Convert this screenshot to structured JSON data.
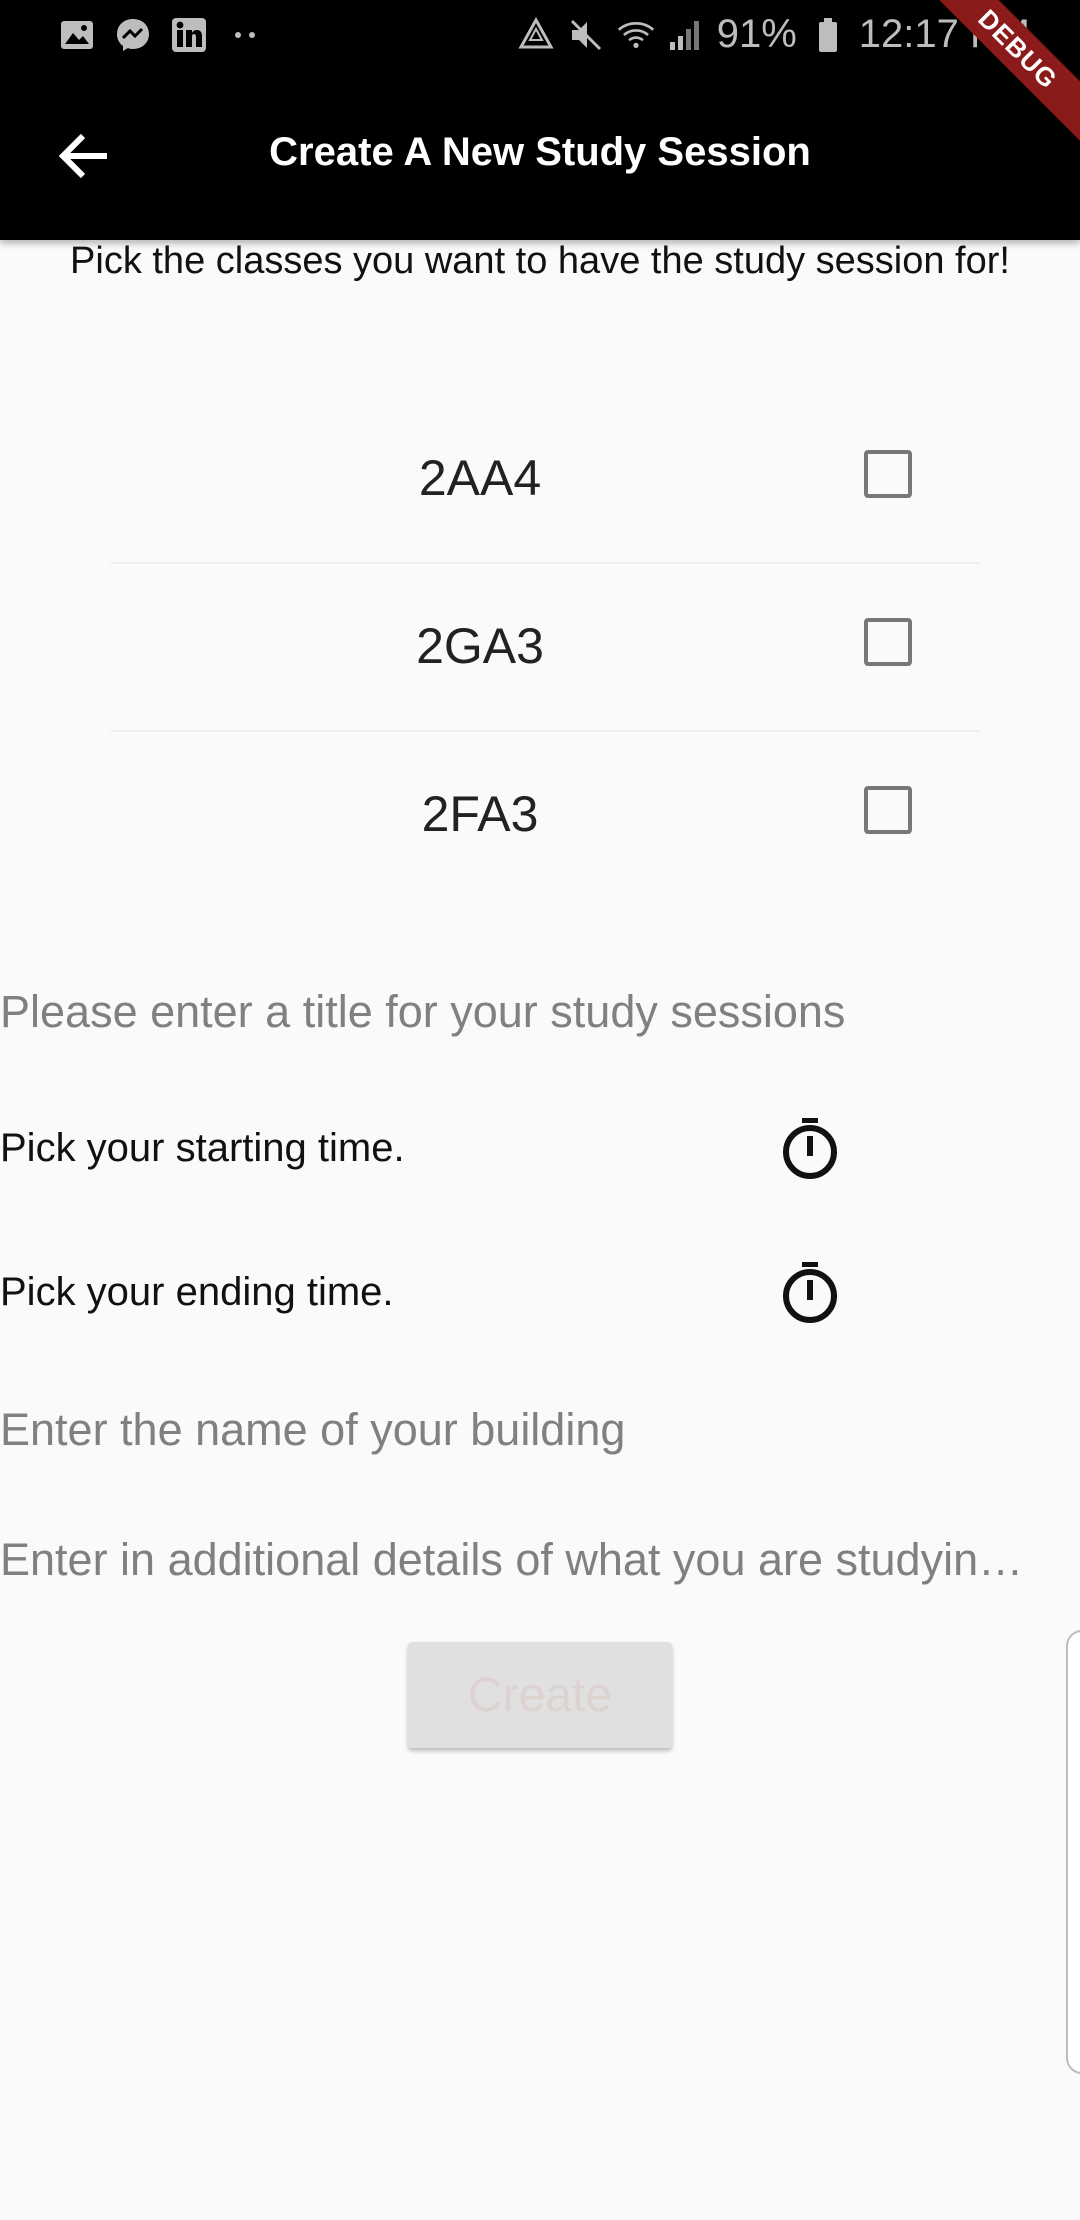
{
  "status_bar": {
    "battery": "91%",
    "time": "12:17 PM",
    "left_icons": [
      "gallery-icon",
      "messenger-icon",
      "linkedin-icon",
      "more-dots-icon"
    ],
    "right_icons": [
      "recycle-icon",
      "mute-icon",
      "wifi-icon",
      "signal-icon",
      "battery-icon"
    ]
  },
  "debug_banner": "DEBUG",
  "app_bar": {
    "title": "Create A New Study Session",
    "back_icon": "arrow-back-icon"
  },
  "instruction": "Pick the classes you want to have  the study session for!",
  "classes": [
    {
      "name": "2AA4",
      "checked": false
    },
    {
      "name": "2GA3",
      "checked": false
    },
    {
      "name": "2FA3",
      "checked": false
    }
  ],
  "form": {
    "title_placeholder": "Please enter a title for your study sessions",
    "start_time_label": "Pick your starting time.",
    "end_time_label": "Pick your ending time.",
    "timer_icon": "timer-icon",
    "building_placeholder": "Enter the name of your building",
    "details_placeholder": "Enter in additional details of what you are studyin…"
  },
  "create_button": "Create",
  "colors": {
    "app_bar": "#000000",
    "background": "#fafafa",
    "debug_banner": "#8b1a1a",
    "button_disabled_bg": "#e0e0e0",
    "button_disabled_text": "#dcd3d0",
    "placeholder": "#808080"
  }
}
